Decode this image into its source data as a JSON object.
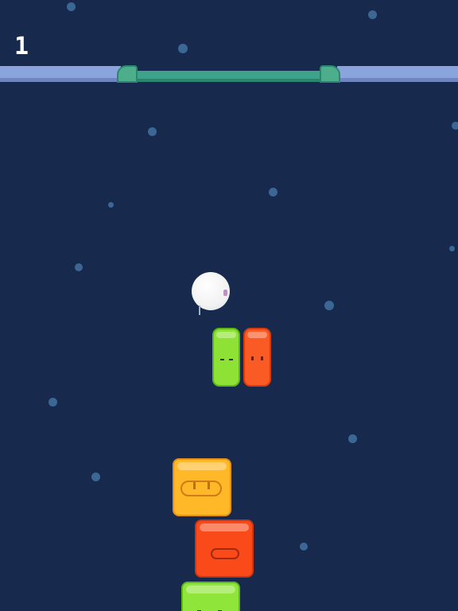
{
  "hud": {
    "score": "1"
  },
  "colors": {
    "background": "#172a4d",
    "rail": "#8aa5db",
    "goal": "#3fa28a",
    "ball": "#ffffff",
    "block_green": "#8ee236",
    "block_red": "#fa5a24",
    "block_orange": "#ffb827"
  },
  "icons": {
    "ball": "white-round-creature",
    "stack": [
      "orange-square-block",
      "red-square-block",
      "green-square-block"
    ],
    "pair": [
      "green-pill-block",
      "red-pill-block"
    ]
  }
}
